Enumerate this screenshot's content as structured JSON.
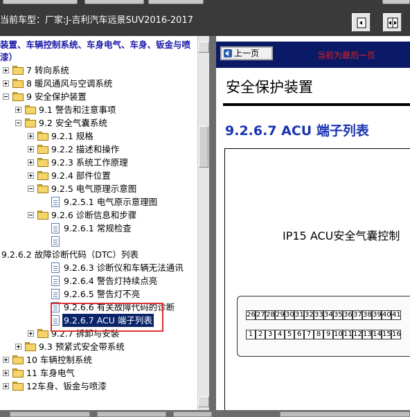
{
  "header": {
    "vehicle_label": "当前车型：厂家:J-吉利汽车远景SUV2016-2017"
  },
  "toolbar": [
    {
      "name": "single-page-button",
      "icon": "single-page-icon"
    },
    {
      "name": "double-page-button",
      "icon": "double-page-icon"
    }
  ],
  "tree": {
    "root_label": "装置、车辆控制系统、车身电气、车身、钣金与喷漆）",
    "nodes": [
      {
        "label": "7 转向系统"
      },
      {
        "label": "8 暖风通风与空调系统"
      },
      {
        "label": "9 安全保护装置"
      },
      {
        "label": "9.1 警告和注意事项"
      },
      {
        "label": "9.2 安全气囊系统"
      },
      {
        "label": "9.2.1 规格"
      },
      {
        "label": "9.2.2 描述和操作"
      },
      {
        "label": "9.2.3 系统工作原理"
      },
      {
        "label": "9.2.4 部件位置"
      },
      {
        "label": "9.2.5 电气原理示意图"
      },
      {
        "label": "9.2.5.1 电气原示意理图"
      },
      {
        "label": "9.2.6 诊断信息和步骤"
      },
      {
        "label": "9.2.6.1 常规检查"
      },
      {
        "label": ""
      },
      {
        "label": "9.2.6.2 故障诊断代码（DTC）列表"
      },
      {
        "label": "9.2.6.3 诊断仪和车辆无法通讯"
      },
      {
        "label": "9.2.6.4 警告灯持续点亮"
      },
      {
        "label": "9.2.6.5 警告灯不亮"
      },
      {
        "label": "9.2.6.6 有关故障代码的诊断"
      },
      {
        "label": "9.2.6.7 ACU 端子列表"
      },
      {
        "label": "9.2.7 拆卸与安装"
      },
      {
        "label": "9.3 预紧式安全带系统"
      },
      {
        "label": "10 车辆控制系统"
      },
      {
        "label": "11 车身电气"
      },
      {
        "label": "12车身、钣金与喷漆"
      }
    ]
  },
  "document": {
    "prev_label": "上一页",
    "last_page_note": "当前为最后一页",
    "section_title": "安全保护装置",
    "page_heading_num": "9.2.6.7 ACU",
    "page_heading_text": "端子列表",
    "connector_label": "IP15 ACU安全气囊控制",
    "pins_top": [
      "26",
      "27",
      "28",
      "29",
      "30",
      "31",
      "32",
      "33",
      "34",
      "35",
      "36",
      "37",
      "38",
      "39",
      "40",
      "41"
    ],
    "pins_bottom": [
      "1",
      "2",
      "3",
      "4",
      "5",
      "6",
      "7",
      "8",
      "9",
      "10",
      "11",
      "12",
      "13",
      "14",
      "15",
      "16"
    ]
  },
  "colors": {
    "doc_header_bg": "#0b1a66",
    "heading_blue": "#1a33b0",
    "highlight_red": "#e03030",
    "note_red": "#e02020"
  }
}
